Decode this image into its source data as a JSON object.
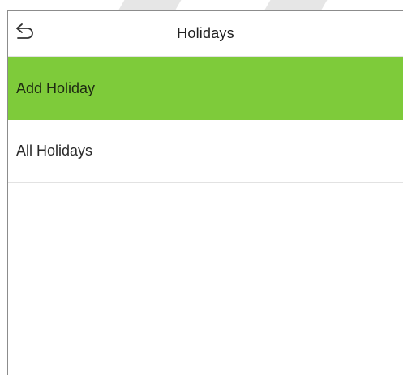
{
  "header": {
    "title": "Holidays",
    "back_icon": "back-arrow-icon"
  },
  "menu": {
    "items": [
      {
        "label": "Add Holiday",
        "selected": true
      },
      {
        "label": "All Holidays",
        "selected": false
      }
    ]
  },
  "colors": {
    "selected_background": "#7ecb3a",
    "border": "#8c8c8c"
  }
}
